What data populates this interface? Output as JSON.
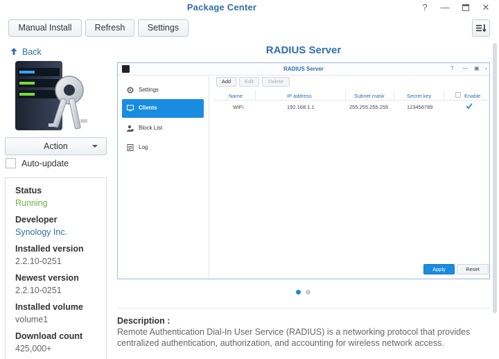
{
  "window": {
    "title": "Package Center"
  },
  "toolbar": {
    "manual_install": "Manual Install",
    "refresh": "Refresh",
    "settings": "Settings"
  },
  "back": "Back",
  "action": {
    "label": "Action"
  },
  "autoupdate": {
    "label": "Auto-update",
    "checked": false
  },
  "info": {
    "status_label": "Status",
    "status_value": "Running",
    "developer_label": "Developer",
    "developer_value": "Synology Inc.",
    "installed_version_label": "Installed version",
    "installed_version_value": "2.2.10-0251",
    "newest_version_label": "Newest version",
    "newest_version_value": "2.2.10-0251",
    "installed_volume_label": "Installed volume",
    "installed_volume_value": "volume1",
    "download_count_label": "Download count",
    "download_count_value": "425,000+"
  },
  "main": {
    "title": "RADIUS Server"
  },
  "screenshot": {
    "title": "RADIUS Server",
    "nav": [
      "Settings",
      "Clients",
      "Block List",
      "Log"
    ],
    "active_nav": "Clients",
    "buttons": {
      "add": "Add",
      "edit": "Edit",
      "delete": "Delete"
    },
    "columns": [
      "Name",
      "IP address",
      "Subnet mask",
      "Secret key",
      "Enable"
    ],
    "row": {
      "name": "WiFi",
      "ip": "192.168.1.1",
      "subnet": "255.255.255.255",
      "secret": "123456789",
      "enable": true
    },
    "apply": "Apply",
    "reset": "Reset"
  },
  "carousel": {
    "count": 2,
    "active": 1
  },
  "description": {
    "heading": "Description :",
    "text": "Remote Authentication Dial-In User Service (RADIUS) is a networking protocol that provides centralized authentication, authorization, and accounting for wireless network access."
  },
  "colors": {
    "accent": "#2f6fad",
    "active_blue": "#1a8ce0",
    "running_green": "#6db33f"
  }
}
